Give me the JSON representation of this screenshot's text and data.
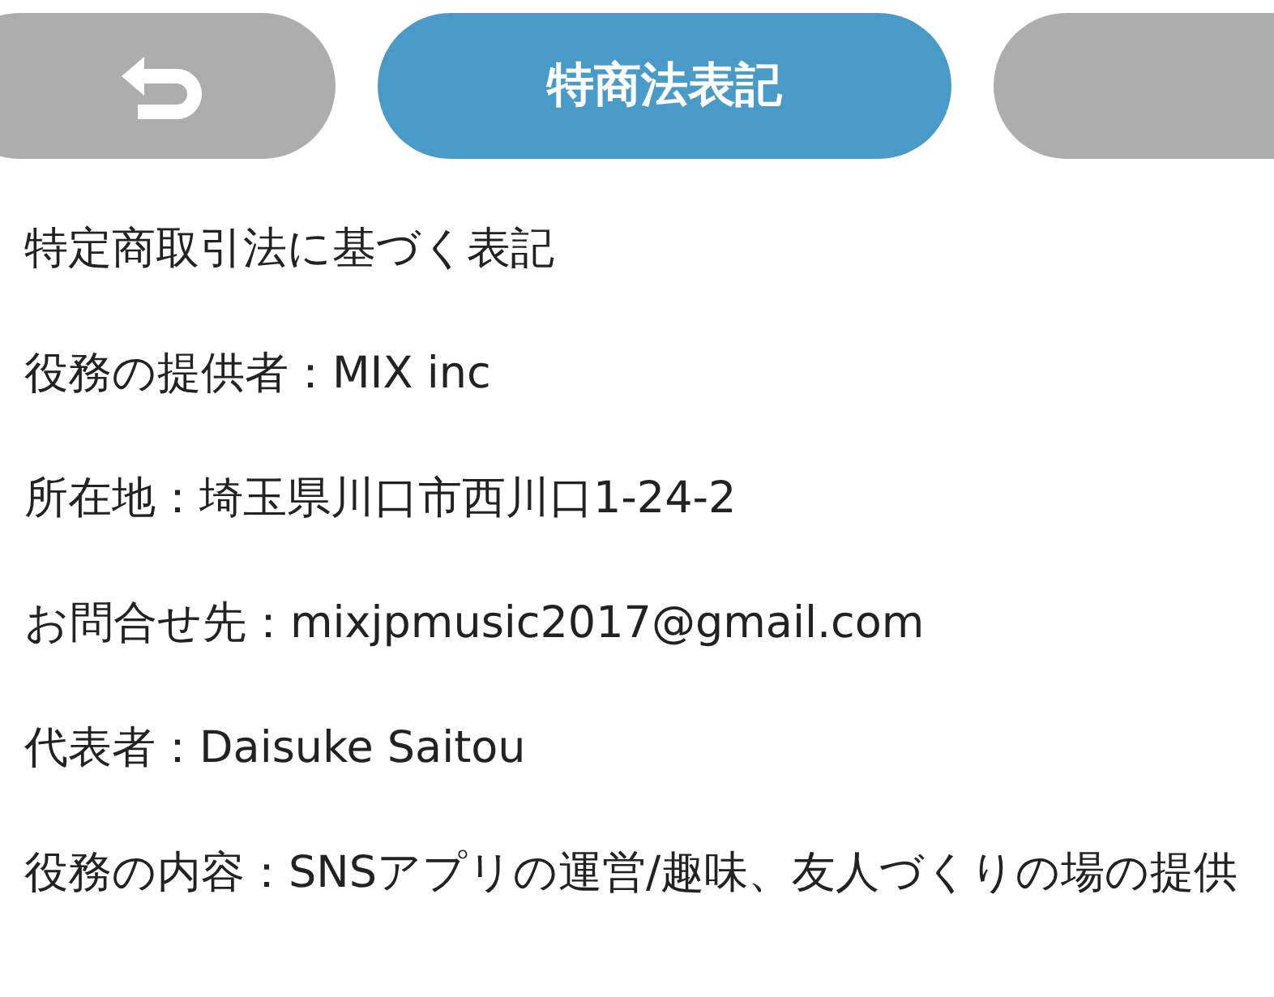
{
  "nav": {
    "title": "特商法表記"
  },
  "lines": [
    "特定商取引法に基づく表記",
    "役務の提供者：MIX inc",
    "所在地：埼玉県川口市西川口1-24-2",
    "お問合せ先：mixjpmusic2017@gmail.com",
    "代表者：Daisuke Saitou",
    "役務の内容：SNSアプリの運営/趣味、友人づくりの場の提供"
  ]
}
